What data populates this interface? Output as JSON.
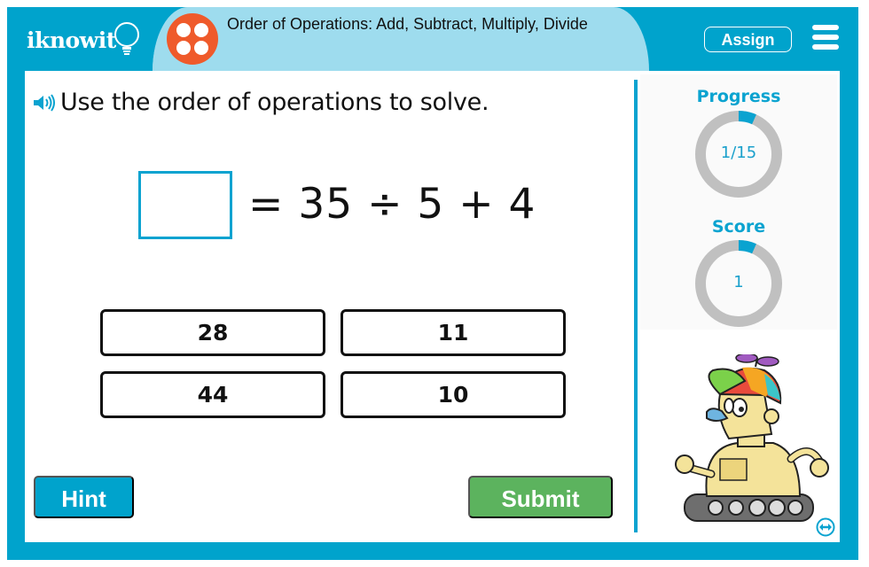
{
  "app": {
    "logo_text": "iknowit",
    "brand_color": "#00a3cc",
    "topic_icon": "four-dots-icon",
    "lesson_title": "Order of Operations: Add, Subtract, Multiply, Divide"
  },
  "header": {
    "assign_label": "Assign",
    "menu_icon": "hamburger-menu-icon"
  },
  "question": {
    "speaker_icon": "speaker-icon",
    "instruction": "Use the order of operations to solve.",
    "equation": "= 35 ÷ 5 + 4",
    "answer_value": ""
  },
  "choices": [
    {
      "label": "28"
    },
    {
      "label": "11"
    },
    {
      "label": "44"
    },
    {
      "label": "10"
    }
  ],
  "actions": {
    "hint_label": "Hint",
    "submit_label": "Submit",
    "submit_color": "#5cb35e"
  },
  "sidebar": {
    "progress": {
      "label": "Progress",
      "text": "1/15",
      "current": 1,
      "total": 15
    },
    "score": {
      "label": "Score",
      "text": "1",
      "value": 1,
      "fraction": 0.0667
    },
    "mascot": "robot-mascot",
    "expand_icon": "expand-arrows-icon"
  }
}
